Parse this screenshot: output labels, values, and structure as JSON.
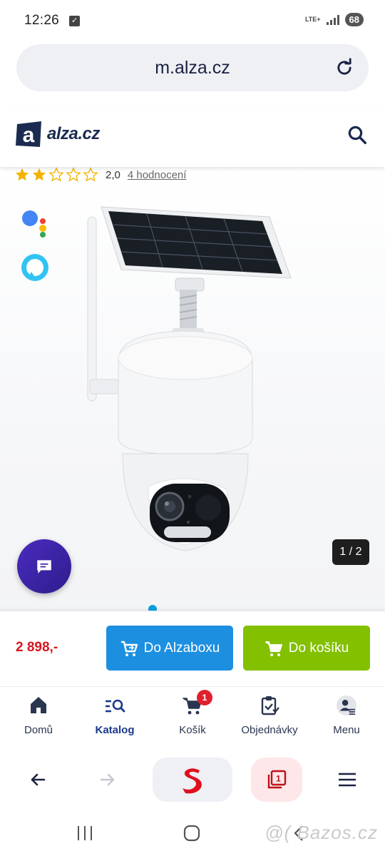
{
  "status_bar": {
    "time": "12:26",
    "network": "LTE+",
    "battery": "68"
  },
  "browser": {
    "url": "m.alza.cz"
  },
  "header": {
    "logo_text": "alza.cz"
  },
  "product": {
    "rating": {
      "stars": 2,
      "max_stars": 5,
      "value": "2,0",
      "reviews_link": "4 hodnocení"
    },
    "gallery_counter": "1 / 2"
  },
  "buy_bar": {
    "price": "2 898,-",
    "alzabox_label": "Do Alzaboxu",
    "cart_label": "Do košíku"
  },
  "site_nav": {
    "items": [
      {
        "label": "Domů",
        "icon": "home-icon"
      },
      {
        "label": "Katalog",
        "icon": "catalog-search-icon",
        "active": true
      },
      {
        "label": "Košík",
        "icon": "cart-icon",
        "badge": "1"
      },
      {
        "label": "Objednávky",
        "icon": "clipboard-check-icon"
      },
      {
        "label": "Menu",
        "icon": "user-menu-icon"
      }
    ]
  },
  "browser_toolbar": {
    "tabs_count": "1"
  },
  "watermark": "@( Bazos.cz",
  "colors": {
    "brand_dark": "#1b2b50",
    "price_red": "#d7171f",
    "alzabox_blue": "#1d8fe0",
    "cart_green": "#82c000",
    "chat_purple": "#3b22a6",
    "active_nav": "#1b3a8c"
  }
}
